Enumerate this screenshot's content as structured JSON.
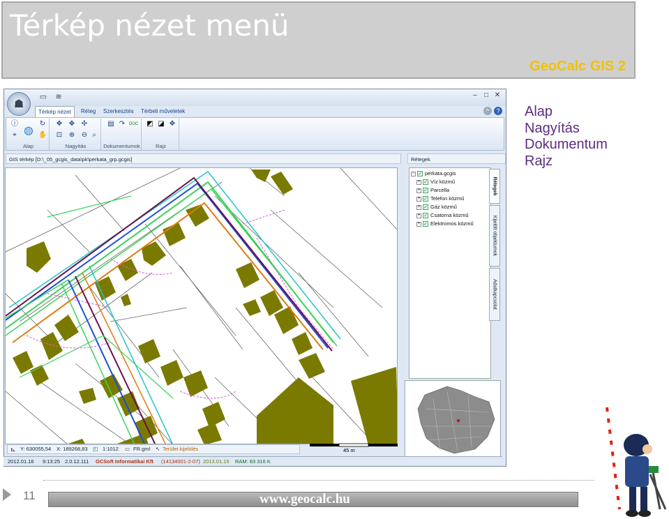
{
  "slide": {
    "title": "Térkép nézet menü",
    "brand": "GeoCalc GIS 2",
    "side_list": [
      "Alap",
      "Nagyítás",
      "Dokumentum",
      "Rajz"
    ],
    "page_number": "11",
    "footer_url": "www.geocalc.hu"
  },
  "app": {
    "tabs": [
      "Térkép nézet",
      "Réteg",
      "Szerkesztés",
      "Térbeli műveletek"
    ],
    "active_tab": "Térkép nézet",
    "ribbon_groups": [
      "Alap",
      "Nagyítás",
      "Dokumentumok",
      "Rajz"
    ],
    "map_header": "GIS térkép [D:\\_05_gcgis_data\\pk\\perkata_grp.gcgis]",
    "layers_header": "Rétegek",
    "layers": {
      "root": "perkata.gcgis",
      "items": [
        "Víz közmű",
        "Parcella",
        "Telefon közmű",
        "Gáz közmű",
        "Csatorna közmű",
        "Elektromos közmű"
      ]
    },
    "side_tabs": [
      "Rétegek",
      "Kijelölt objektumok",
      "Adatkapcsolat"
    ],
    "coord_bar": {
      "y": "Y: 630055,54",
      "x": "X: 189268,83",
      "scale": "1:1012",
      "file": "FR.gml",
      "mode": "Terület kijelölés"
    },
    "scale_label": "45 m",
    "status_bar": {
      "date": "2012.01.16",
      "time": "9:13:25",
      "version": "2.0.12.111",
      "company": "GCSoft Informatikai Kft",
      "license": "(14134001-2-07)",
      "expiry": "2013.01.15",
      "ram": "RAM: 83 316 K"
    }
  },
  "colors": {
    "title_bar": "#cfcfcf",
    "brand": "#f2c200",
    "side_list": "#5b2c80",
    "building": "#7a7a00",
    "water": "#1b4fd6",
    "gas": "#e07a10",
    "sewer": "#6b0f4f",
    "electric": "#3cd35a",
    "telephone": "#22c6c6",
    "parcel": "#555555",
    "dashed": "#e055e0"
  }
}
